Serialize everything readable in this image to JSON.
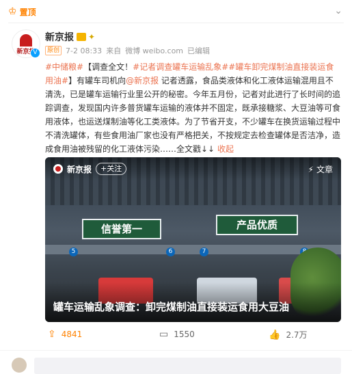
{
  "top": {
    "label": "置顶"
  },
  "author": {
    "name": "新京报",
    "avatar_text": "新京报"
  },
  "meta": {
    "tag": "原创",
    "time": "7-2 08:33",
    "source_prefix": "来自",
    "source": "微博 weibo.com",
    "edited": "已编辑"
  },
  "post": {
    "hashtag1": "#中储粮#",
    "text1": "【调查全文！",
    "hashtag2": "#记者调查罐车运输乱象#",
    "hashtag3": "#罐车卸完煤制油直接装运食用油#",
    "text2": "】有罐车司机向",
    "mention": "@新京报",
    "text3": " 记者透露，食品类液体和化工液体运输混用且不清洗，已是罐车运输行业里公开的秘密。今年五月份，记者对此进行了长时间的追踪调查，发现国内许多普货罐车运输的液体并不固定，既承接糖浆、大豆油等可食用液体，也运送煤制油等化工类液体。为了节省开支，不少罐车在换货运输过程中不清洗罐体，有些食用油厂家也没有严格把关，不按规定去检查罐体是否洁净，造成食用油被残留的化工液体污染……全文戳↓↓",
    "collapse": "收起"
  },
  "media": {
    "source_name": "新京报",
    "follow_label": "+关注",
    "article_label": "文章",
    "sign1": "信誉第一",
    "sign2": "产品优质",
    "numbers": [
      "5",
      "6",
      "7",
      "8"
    ],
    "headline": "罐车运输乱象调查：卸完煤制油直接装运食用大豆油"
  },
  "actions": {
    "reposts": "4841",
    "comments": "1550",
    "likes": "2.7万"
  },
  "colors": {
    "accent": "#ff8200",
    "link": "#eb7350",
    "badge": "#0aa0ff"
  },
  "icons": {
    "top": "crown-icon",
    "more": "chevron-down-icon",
    "verified": "verified-badge-icon",
    "repost": "repost-icon",
    "comment": "comment-icon",
    "like": "like-icon",
    "article": "lightning-icon"
  }
}
